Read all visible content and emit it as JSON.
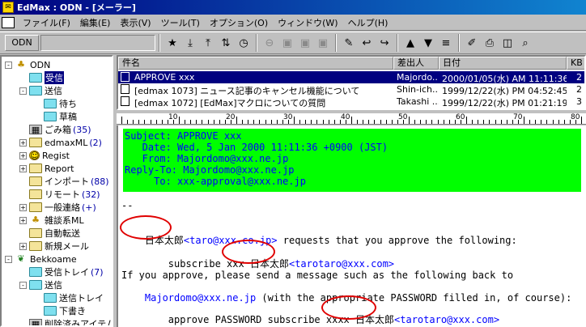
{
  "window": {
    "title": "EdMax : ODN - [メーラー]"
  },
  "menu": [
    "ファイル(F)",
    "編集(E)",
    "表示(V)",
    "ツール(T)",
    "オプション(O)",
    "ウィンドウ(W)",
    "ヘルプ(H)"
  ],
  "toolbar": {
    "account_tab": "ODN",
    "buttons": [
      {
        "name": "new-folder-icon",
        "glyph": "★"
      },
      {
        "name": "receive-icon",
        "glyph": "⤓"
      },
      {
        "name": "send-icon",
        "glyph": "⤒"
      },
      {
        "name": "send-receive-icon",
        "glyph": "⇅"
      },
      {
        "name": "clock-icon",
        "glyph": "◷"
      },
      {
        "name": "stop-icon",
        "glyph": "⊖"
      },
      {
        "name": "cut-icon",
        "glyph": "▣"
      },
      {
        "name": "copy-icon",
        "glyph": "▣"
      },
      {
        "name": "paste-icon",
        "glyph": "▣"
      },
      {
        "name": "new-message-icon",
        "glyph": "✎"
      },
      {
        "name": "reply-icon",
        "glyph": "↩"
      },
      {
        "name": "forward-icon",
        "glyph": "↪"
      },
      {
        "name": "prev-icon",
        "glyph": "▲"
      },
      {
        "name": "next-icon",
        "glyph": "▼"
      },
      {
        "name": "thread-icon",
        "glyph": "≡"
      },
      {
        "name": "attach-icon",
        "glyph": "✐"
      },
      {
        "name": "print-icon",
        "glyph": "⎙"
      },
      {
        "name": "addressbook-icon",
        "glyph": "◫"
      },
      {
        "name": "find-icon",
        "glyph": "⌕"
      }
    ]
  },
  "tree": {
    "rows": [
      {
        "label": "ODN",
        "icon": "duck",
        "count": "",
        "box": "-"
      },
      {
        "label": "受信",
        "icon": "folder-cyan",
        "count": "",
        "box": "",
        "selected": true
      },
      {
        "label": "送信",
        "icon": "folder-cyan",
        "count": "",
        "box": "-"
      },
      {
        "label": "待ち",
        "icon": "folder-cyan",
        "count": "",
        "box": ""
      },
      {
        "label": "草稿",
        "icon": "folder-cyan",
        "count": "",
        "box": ""
      },
      {
        "label": "ごみ箱",
        "icon": "trash",
        "count": "(35)",
        "box": ""
      },
      {
        "label": "edmaxML",
        "icon": "folder",
        "count": "(2)",
        "box": "+"
      },
      {
        "label": "Regist",
        "icon": "smile",
        "count": "",
        "box": "+"
      },
      {
        "label": "Report",
        "icon": "folder",
        "count": "",
        "box": "+"
      },
      {
        "label": "インポート",
        "icon": "folder",
        "count": "(88)",
        "box": ""
      },
      {
        "label": "リモート",
        "icon": "folder",
        "count": "(32)",
        "box": ""
      },
      {
        "label": "一般連絡",
        "icon": "folder",
        "count": "(+)",
        "box": "+"
      },
      {
        "label": "雑談系ML",
        "icon": "duck",
        "count": "",
        "box": "+"
      },
      {
        "label": "自動転送",
        "icon": "folder",
        "count": "",
        "box": ""
      },
      {
        "label": "新規メール",
        "icon": "folder",
        "count": "",
        "box": "+"
      },
      {
        "label": "Bekkoame",
        "icon": "bug",
        "count": "",
        "box": "-"
      },
      {
        "label": "受信トレイ",
        "icon": "folder-cyan",
        "count": "(7)",
        "box": ""
      },
      {
        "label": "送信",
        "icon": "folder-cyan",
        "count": "",
        "box": "-"
      },
      {
        "label": "送信トレイ",
        "icon": "folder-cyan",
        "count": "",
        "box": ""
      },
      {
        "label": "下書き",
        "icon": "folder-cyan",
        "count": "",
        "box": ""
      },
      {
        "label": "削除済みアイテム",
        "icon": "trash",
        "count": "",
        "box": ""
      }
    ]
  },
  "list": {
    "columns": [
      "件名",
      "差出人",
      "日付",
      "KB"
    ],
    "rows": [
      {
        "subject": "APPROVE xxx",
        "from": "Majordo...",
        "date": "2000/01/05(水) AM 11:11:36",
        "kb": "2",
        "selected": true
      },
      {
        "subject": "[edmax 1073] ニュース記事のキャンセル機能について",
        "from": "Shin-ich...",
        "date": "1999/12/22(水) PM 04:52:45",
        "kb": "2",
        "selected": false
      },
      {
        "subject": "[edmax 1072] [EdMax]マクロについての質問",
        "from": "Takashi ...",
        "date": "1999/12/22(水) PM 01:21:19",
        "kb": "3",
        "selected": false
      }
    ]
  },
  "ruler": {
    "labels": [
      "10",
      "20",
      "30",
      "40",
      "50",
      "60",
      "70",
      "80"
    ]
  },
  "preview": {
    "headers": [
      "Subject: APPROVE xxx",
      "   Date: Wed, 5 Jan 2000 11:11:36 +0900 (JST)",
      "   From: Majordomo@xxx.ne.jp",
      "Reply-To: Majordomo@xxx.ne.jp",
      "     To: xxx-approval@xxx.ne.jp"
    ],
    "sep": "--",
    "name": "日本太郎",
    "line1_email": "<taro@xxx.co.jp>",
    "line1_rest": " requests that you approve the following:",
    "line2_pre": "    subscribe xxx ",
    "line2_email": "<tarotaro@xxx.com>",
    "line3": "If you approve, please send a message such as the following back to",
    "line4_link": "Majordomo@xxx.ne.jp",
    "line4_rest": " (with the appropriate PASSWORD filled in, of course):",
    "line5_pre": "    approve PASSWORD subscribe xxxx ",
    "line5_email": "<tarotaro@xxx.com>"
  },
  "colors": {
    "titlebar": "#000080",
    "header_bg": "#00ff00",
    "header_text": "#0000ff",
    "annotation": "#e00000"
  }
}
